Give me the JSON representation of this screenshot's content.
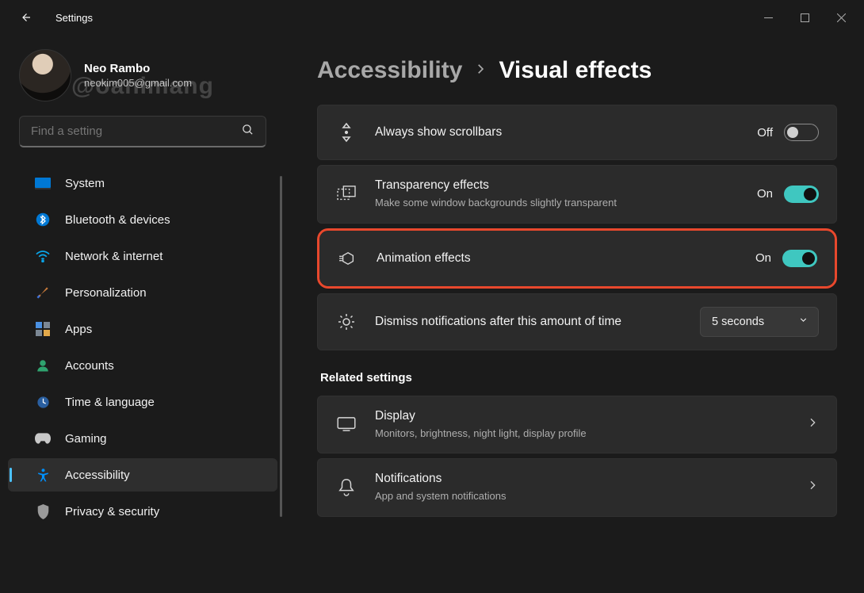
{
  "window": {
    "title": "Settings"
  },
  "profile": {
    "name": "Neo Rambo",
    "email": "neokim005@gmail.com",
    "watermark": "@oanimang"
  },
  "search": {
    "placeholder": "Find a setting"
  },
  "sidebar": {
    "items": [
      {
        "icon": "monitor",
        "label": "System"
      },
      {
        "icon": "bluetooth",
        "label": "Bluetooth & devices"
      },
      {
        "icon": "wifi",
        "label": "Network & internet"
      },
      {
        "icon": "brush",
        "label": "Personalization"
      },
      {
        "icon": "apps",
        "label": "Apps"
      },
      {
        "icon": "person",
        "label": "Accounts"
      },
      {
        "icon": "clock-globe",
        "label": "Time & language"
      },
      {
        "icon": "gamepad",
        "label": "Gaming"
      },
      {
        "icon": "accessibility",
        "label": "Accessibility",
        "active": true
      },
      {
        "icon": "shield",
        "label": "Privacy & security"
      }
    ]
  },
  "breadcrumb": {
    "parent": "Accessibility",
    "current": "Visual effects"
  },
  "settings": {
    "scrollbars": {
      "title": "Always show scrollbars",
      "state_label": "Off",
      "on": false
    },
    "transparency": {
      "title": "Transparency effects",
      "sub": "Make some window backgrounds slightly transparent",
      "state_label": "On",
      "on": true
    },
    "animation": {
      "title": "Animation effects",
      "state_label": "On",
      "on": true
    },
    "dismiss": {
      "title": "Dismiss notifications after this amount of time",
      "value": "5 seconds"
    }
  },
  "related": {
    "heading": "Related settings",
    "display": {
      "title": "Display",
      "sub": "Monitors, brightness, night light, display profile"
    },
    "notifications": {
      "title": "Notifications",
      "sub": "App and system notifications"
    }
  }
}
